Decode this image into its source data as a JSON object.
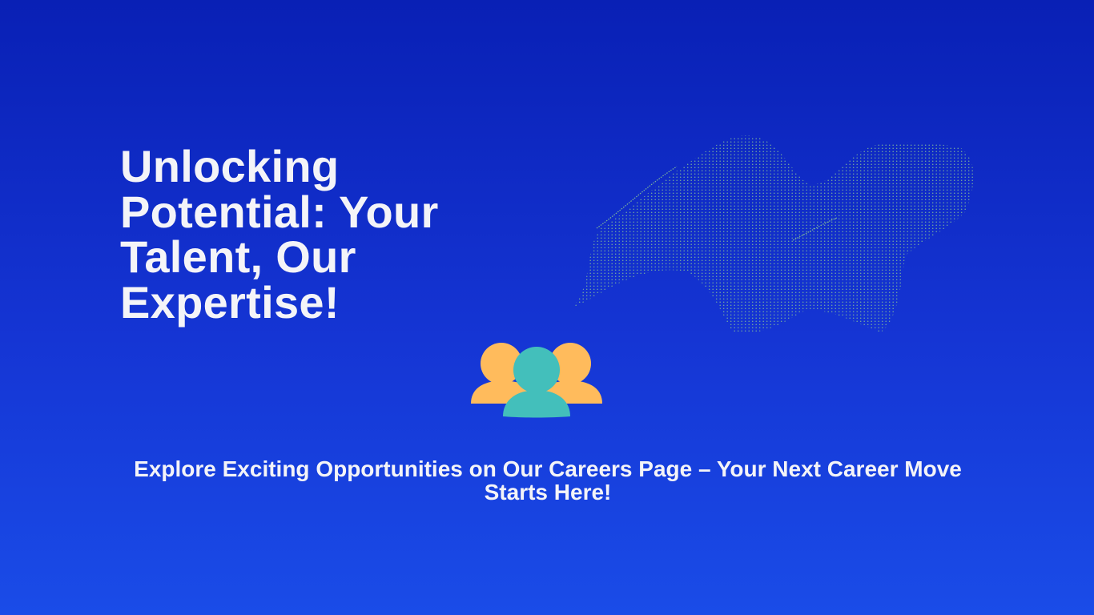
{
  "hero": {
    "title": "Unlocking Potential: Your Talent, Our Expertise!",
    "subtitle": "Explore Exciting Opportunities on Our Careers Page – Your Next Career Move Starts Here!"
  },
  "icons": {
    "graphic": "dotted-wave-mesh",
    "people": "team-people-icon"
  },
  "colors": {
    "background_top": "#0920b5",
    "background_bottom": "#1a4ce8",
    "people_side": "#ffbb5c",
    "people_center": "#43bfbb",
    "wave_dots": "#7fb89a"
  }
}
